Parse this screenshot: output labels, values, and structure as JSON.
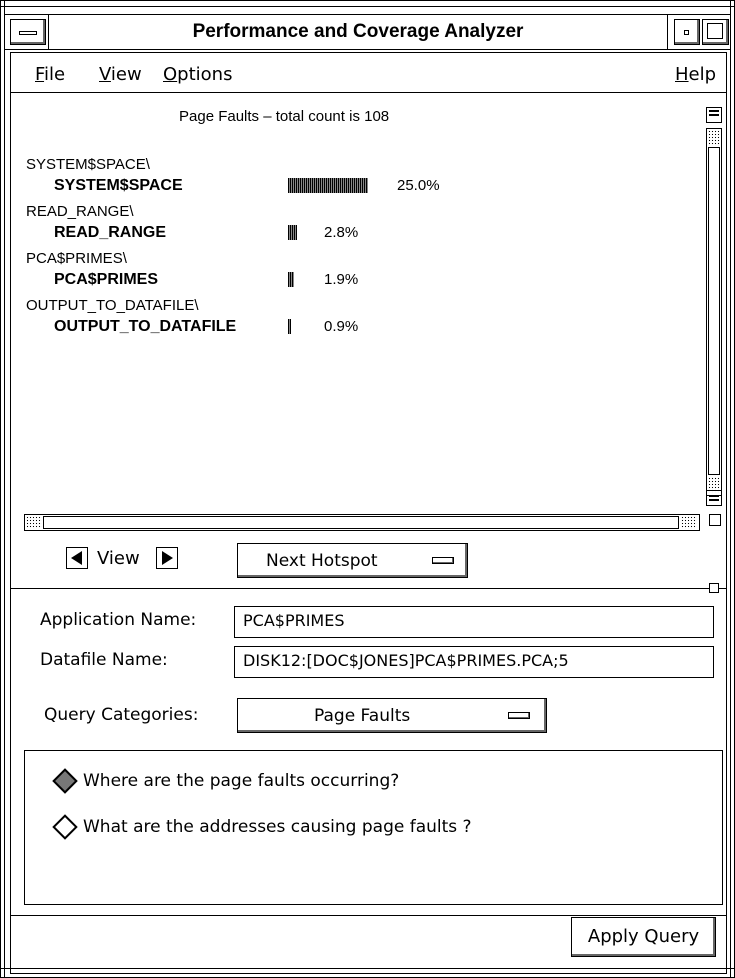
{
  "window": {
    "title": "Performance and Coverage Analyzer"
  },
  "menu": {
    "file_first": "F",
    "file_rest": "ile",
    "view_first": "V",
    "view_rest": "iew",
    "options_first": "O",
    "options_rest": "ptions",
    "help_first": "H",
    "help_rest": "elp"
  },
  "display": {
    "heading": "Page Faults – total count is 108",
    "entries": [
      {
        "path": "SYSTEM$SPACE\\",
        "name": "SYSTEM$SPACE",
        "percent": "25.0%",
        "value": 25.0
      },
      {
        "path": "READ_RANGE\\",
        "name": "READ_RANGE",
        "percent": "2.8%",
        "value": 2.8
      },
      {
        "path": "PCA$PRIMES\\",
        "name": "PCA$PRIMES",
        "percent": "1.9%",
        "value": 1.9
      },
      {
        "path": "OUTPUT_TO_DATAFILE\\",
        "name": "OUTPUT_TO_DATAFILE",
        "percent": "0.9%",
        "value": 0.9
      }
    ]
  },
  "nav": {
    "view_label": "View",
    "hotspot_label": "Next Hotspot"
  },
  "form": {
    "app_label": "Application Name:",
    "app_value": "PCA$PRIMES",
    "datafile_label": "Datafile Name:",
    "datafile_value": "DISK12:[DOC$JONES]PCA$PRIMES.PCA;5",
    "query_label": "Query Categories:",
    "query_value": "Page Faults"
  },
  "queries": [
    {
      "label": "Where are the page faults occurring?",
      "selected": true
    },
    {
      "label": "What are the addresses causing page faults ?",
      "selected": false
    }
  ],
  "actions": {
    "apply_label": "Apply Query"
  }
}
